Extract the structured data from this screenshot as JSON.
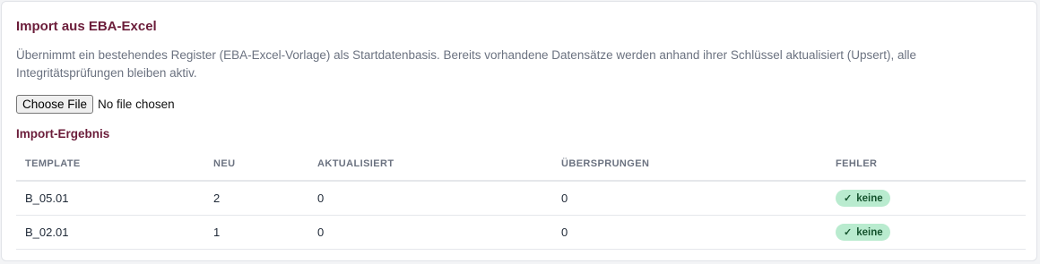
{
  "card": {
    "title": "Import aus EBA-Excel",
    "description": "Übernimmt ein bestehendes Register (EBA-Excel-Vorlage) als Startdatenbasis. Bereits vorhandene Datensätze werden anhand ihrer Schlüssel aktualisiert (Upsert), alle Integritätsprüfungen bleiben aktiv.",
    "file_button": "Choose File",
    "file_status": "No file chosen"
  },
  "results": {
    "title": "Import-Ergebnis",
    "columns": [
      "TEMPLATE",
      "NEU",
      "AKTUALISIERT",
      "ÜBERSPRUNGEN",
      "FEHLER"
    ],
    "rows": [
      {
        "template": "B_05.01",
        "neu": "2",
        "aktualisiert": "0",
        "uebersprungen": "0",
        "fehler_icon": "check-icon",
        "fehler": "keine"
      },
      {
        "template": "B_02.01",
        "neu": "1",
        "aktualisiert": "0",
        "uebersprungen": "0",
        "fehler_icon": "check-icon",
        "fehler": "keine"
      }
    ]
  },
  "colors": {
    "accent": "#6b1d3a",
    "badge_bg": "#b9ebcf",
    "badge_text": "#14532d"
  }
}
